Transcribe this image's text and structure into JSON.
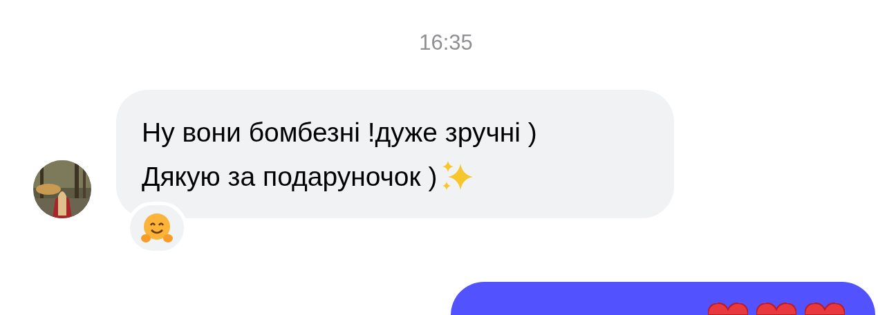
{
  "timestamp": "16:35",
  "incoming_message": {
    "lines": [
      "Ну вони бомбезні !дуже зручні )",
      "Дякую за подаруночок )"
    ]
  },
  "outgoing_message": {
    "kind": "cut_off"
  }
}
